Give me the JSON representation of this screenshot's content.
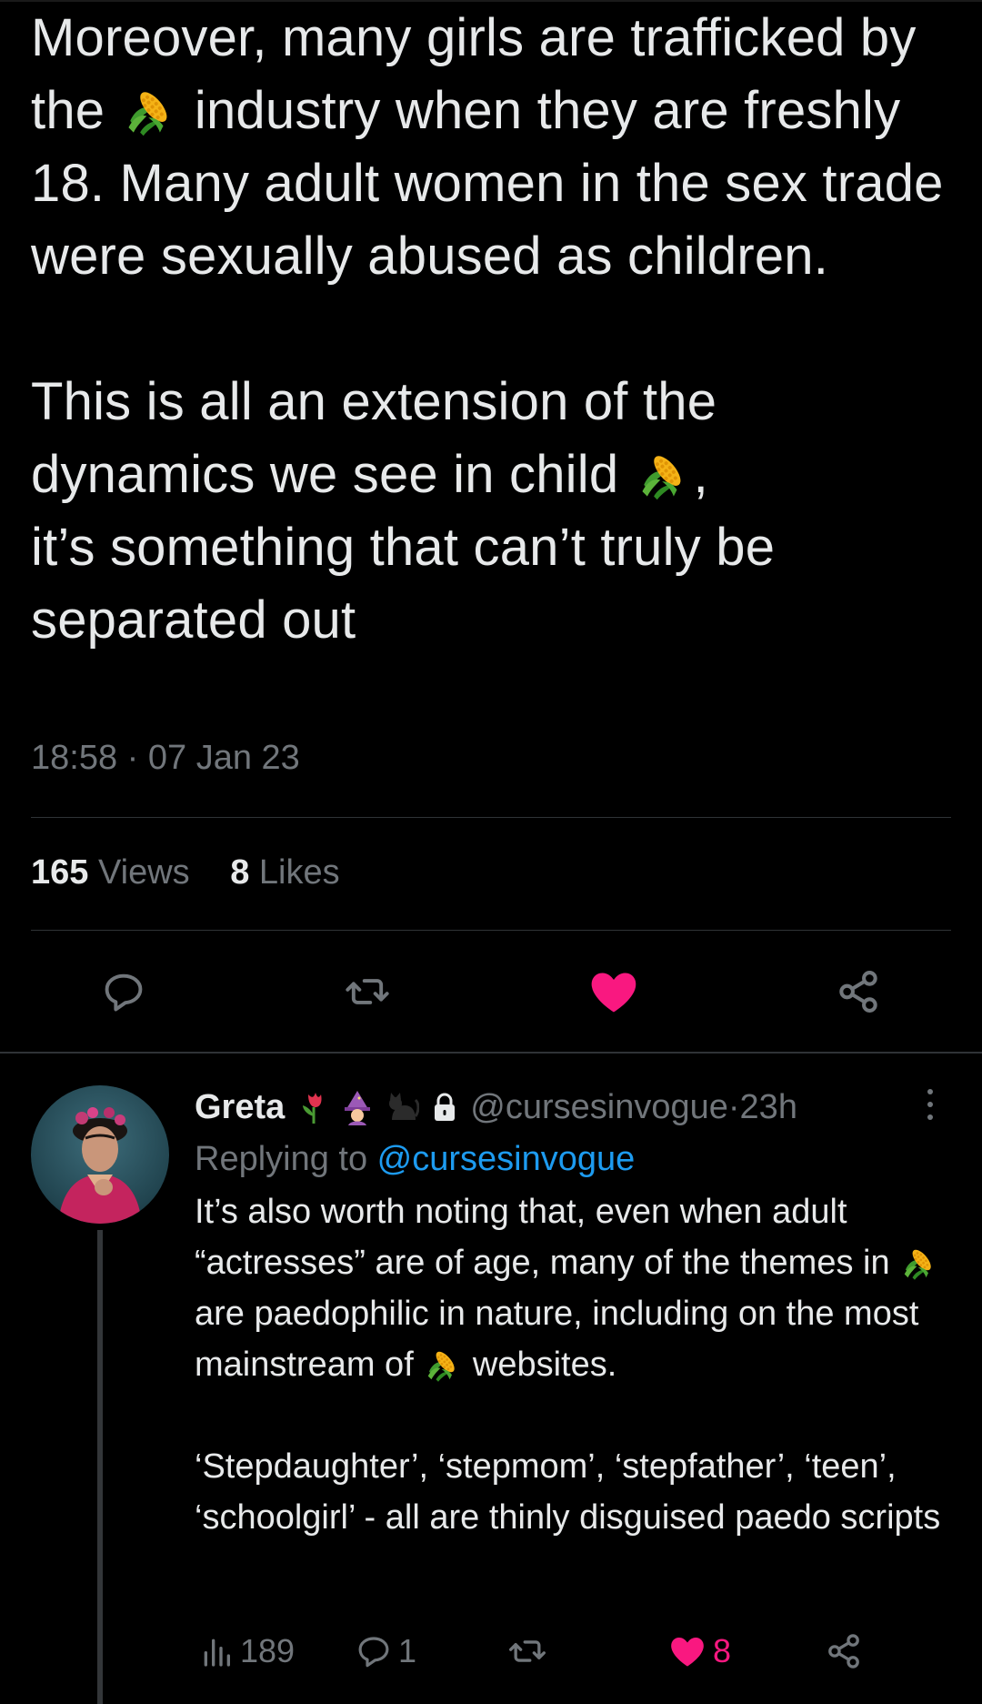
{
  "main_tweet": {
    "paragraph1_part1": "Moreover, many girls are trafficked by the ",
    "paragraph1_part2": " industry when they are freshly 18. Many adult women in the sex trade were sexually abused as children.",
    "paragraph2_part1": "This is all an extension of the dynamics we see in child ",
    "paragraph2_part2": ",\nit’s something that can’t truly be separated out",
    "time": "18:58",
    "separator": " · ",
    "date": "07 Jan 23",
    "views_count": "165",
    "views_label": "Views",
    "likes_count": "8",
    "likes_label": "Likes"
  },
  "icons": {
    "reply": "reply-icon",
    "retweet": "retweet-icon",
    "like": "heart-icon",
    "share": "share-icon",
    "corn": "corn-emoji",
    "more": "more-icon",
    "analytics": "analytics-icon",
    "lock": "lock-icon"
  },
  "colors": {
    "background": "#000000",
    "text": "#e7e9ea",
    "muted": "#71767b",
    "link": "#1d9bf0",
    "like": "#f91880"
  },
  "reply": {
    "name": "Greta",
    "handle": "@cursesinvogue",
    "time_sep": " · ",
    "time": "23h",
    "replying_prefix": "Replying to ",
    "replying_handle": "@cursesinvogue",
    "p1_a": "It’s also worth noting that, even when adult “actresses” are of age, many of the themes in ",
    "p1_b": " are paedophilic in nature, including on the most mainstream of ",
    "p1_c": " websites.",
    "p2": "‘Stepdaughter’, ‘stepmom’, ‘stepfather’, ‘teen’, ‘schoolgirl’ - all are thinly disguised paedo scripts",
    "views": "189",
    "replies": "1",
    "likes": "8"
  }
}
